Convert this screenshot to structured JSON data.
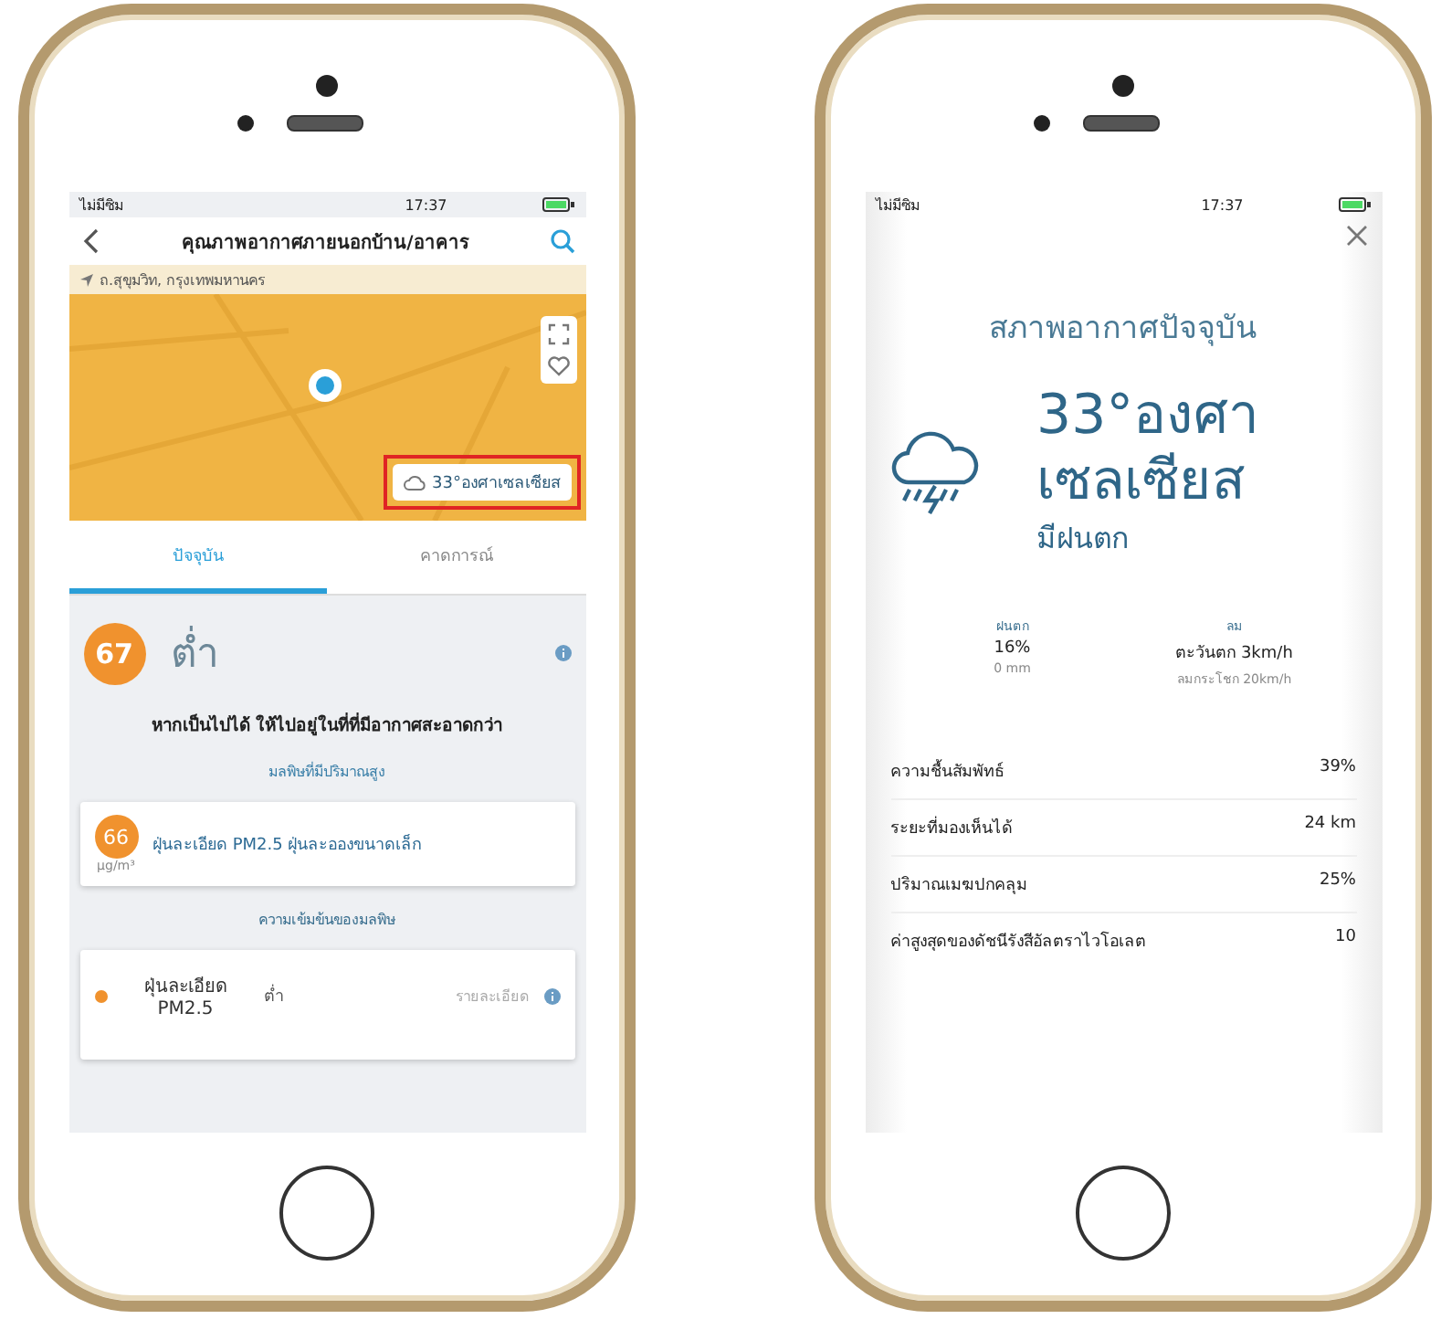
{
  "air_quality_screen": {
    "status_bar": {
      "carrier": "ไม่มีซิม",
      "time": "17:37"
    },
    "title": "คุณภาพอากาศภายนอกบ้าน/อาคาร",
    "location": "ถ.สุขุมวิท, กรุงเทพมหานคร",
    "map": {
      "temperature": "33°องศาเซลเซียส",
      "highlighted": true
    },
    "tabs": [
      {
        "label": "ปัจจุบัน",
        "selected": true
      },
      {
        "label": "คาดการณ์",
        "selected": false
      }
    ],
    "aqi": {
      "value": "67",
      "level_label": "ต่ำ",
      "advice": "หากเป็นไปได้ ให้ไปอยู่ในที่ที่มีอากาศสะอาดกว่า",
      "link": "มลพิษที่มีปริมาณสูง"
    },
    "pollutant_card": {
      "value": "66",
      "unit": "µg/m³",
      "text": "ฝุ่นละเอียด PM2.5 ฝุ่นละอองขนาดเล็ก"
    },
    "section_title": "ความเข้มข้นของมลพิษ",
    "pollutants": [
      {
        "name": "ฝุ่นละเอียด PM2.5",
        "level": "ต่ำ",
        "detail": "รายละเอียด",
        "color": "#f0922e"
      }
    ]
  },
  "weather_screen": {
    "status_bar": {
      "carrier": "ไม่มีซิม",
      "time": "17:37"
    },
    "title": "สภาพอากาศปัจจุบัน",
    "temperature": "33°องศา เซลเซียส",
    "condition": "มีฝนตก",
    "stats": [
      {
        "label": "ฝนตก",
        "value": "16%",
        "sub": "0 mm"
      },
      {
        "label": "ลม",
        "value": "ตะวันตก 3km/h",
        "sub": "ลมกระโชก 20km/h"
      }
    ],
    "details": [
      {
        "label": "ความชื้นสัมพัทธ์",
        "value": "39%"
      },
      {
        "label": "ระยะที่มองเห็นได้",
        "value": "24 km"
      },
      {
        "label": "ปริมาณเมฆปกคลุม",
        "value": "25%"
      },
      {
        "label": "ค่าสูงสุดของดัชนีรังสีอัลตราไวโอเลต",
        "value": "10"
      }
    ]
  }
}
